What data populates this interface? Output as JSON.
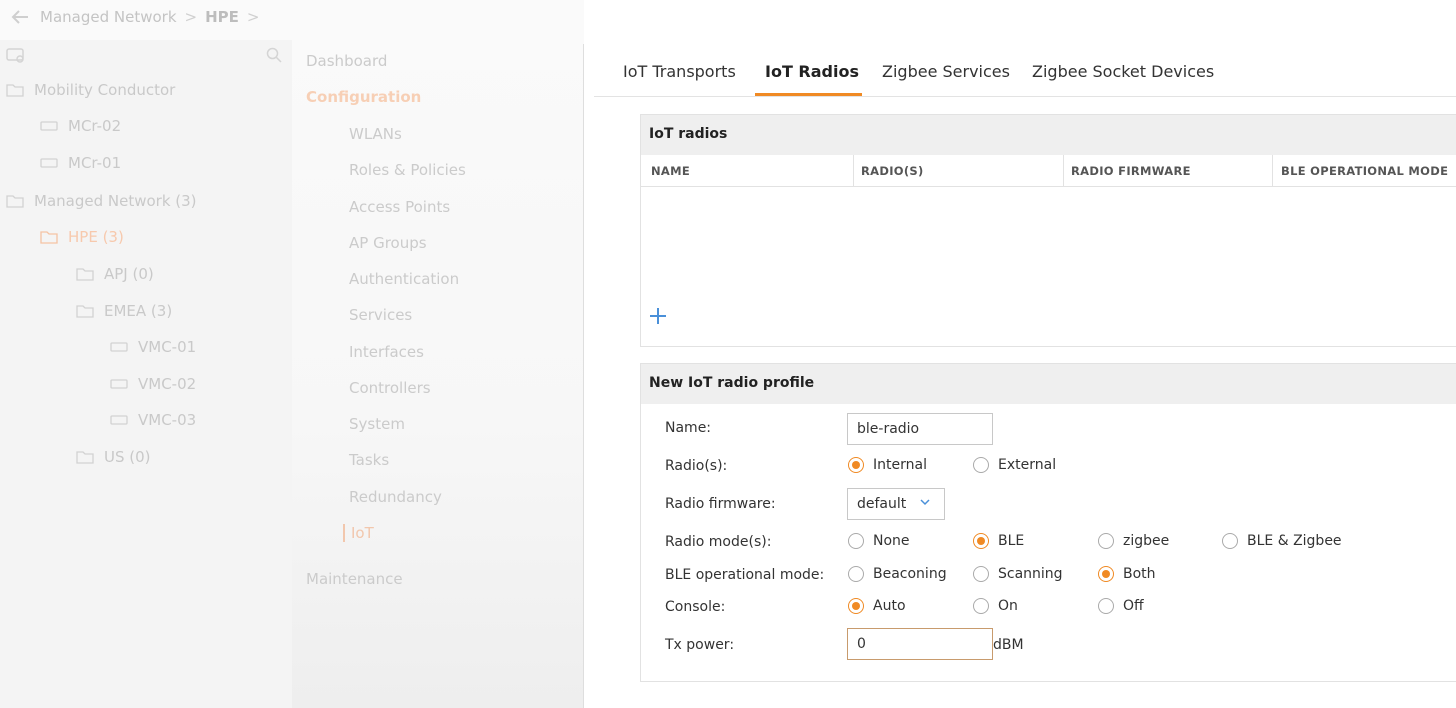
{
  "breadcrumb": {
    "root": "Managed Network",
    "current": "HPE"
  },
  "tree": {
    "items": [
      {
        "label": "Mobility Conductor"
      },
      {
        "label": "MCr-02"
      },
      {
        "label": "MCr-01"
      },
      {
        "label": "Managed Network (3)"
      },
      {
        "label": "HPE (3)"
      },
      {
        "label": "APJ (0)"
      },
      {
        "label": "EMEA (3)"
      },
      {
        "label": "VMC-01"
      },
      {
        "label": "VMC-02"
      },
      {
        "label": "VMC-03"
      },
      {
        "label": "US (0)"
      }
    ]
  },
  "nav": {
    "dashboard": "Dashboard",
    "configuration": "Configuration",
    "items": [
      "WLANs",
      "Roles & Policies",
      "Access Points",
      "AP Groups",
      "Authentication",
      "Services",
      "Interfaces",
      "Controllers",
      "System",
      "Tasks",
      "Redundancy",
      "IoT"
    ],
    "maintenance": "Maintenance"
  },
  "tabs": [
    "IoT Transports",
    "IoT Radios",
    "Zigbee Services",
    "Zigbee Socket Devices"
  ],
  "radios_table": {
    "title": "IoT radios",
    "columns": [
      "NAME",
      "RADIO(S)",
      "RADIO FIRMWARE",
      "BLE OPERATIONAL MODE"
    ]
  },
  "profile": {
    "title": "New IoT radio profile",
    "name_label": "Name:",
    "name_value": "ble-radio",
    "radios_label": "Radio(s):",
    "radios_options": [
      "Internal",
      "External"
    ],
    "firmware_label": "Radio firmware:",
    "firmware_value": "default",
    "mode_label": "Radio mode(s):",
    "mode_options": [
      "None",
      "BLE",
      "zigbee",
      "BLE & Zigbee"
    ],
    "ble_label": "BLE operational mode:",
    "ble_options": [
      "Beaconing",
      "Scanning",
      "Both"
    ],
    "console_label": "Console:",
    "console_options": [
      "Auto",
      "On",
      "Off"
    ],
    "tx_label": "Tx power:",
    "tx_value": "0",
    "tx_unit": "dBM"
  },
  "colors": {
    "accent": "#f08a24"
  }
}
